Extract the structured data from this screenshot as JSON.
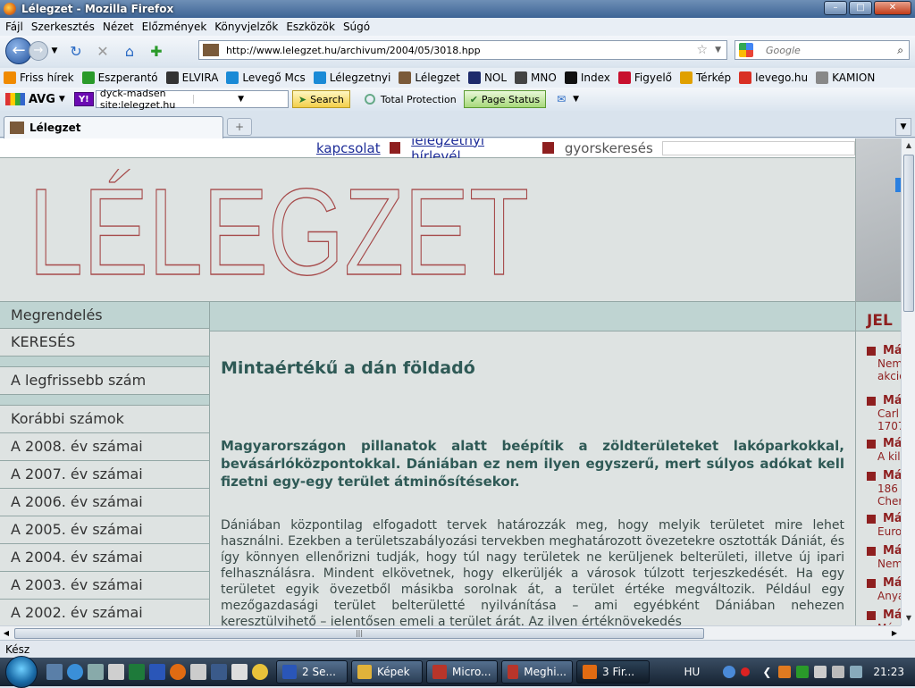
{
  "window": {
    "title": "Lélegzet - Mozilla Firefox",
    "buttons": [
      "–",
      "□",
      "✕"
    ]
  },
  "menu": [
    "Fájl",
    "Szerkesztés",
    "Nézet",
    "Előzmények",
    "Könyvjelzők",
    "Eszközök",
    "Súgó"
  ],
  "nav": {
    "url": "http://www.lelegzet.hu/archivum/2004/05/3018.hpp",
    "search_placeholder": "Google"
  },
  "bookmarks": [
    {
      "label": "Friss hírek",
      "icon": "rss-icon",
      "color": "#f08a00"
    },
    {
      "label": "Eszperantó",
      "icon": "flag-icon",
      "color": "#2a9a2a"
    },
    {
      "label": "ELVIRA",
      "icon": "train-icon",
      "color": "#333333"
    },
    {
      "label": "Levegő Mcs",
      "icon": "snowflake-icon",
      "color": "#1a8ad6"
    },
    {
      "label": "Lélegzetnyi",
      "icon": "snowflake-icon",
      "color": "#1a8ad6"
    },
    {
      "label": "Lélegzet",
      "icon": "site-icon",
      "color": "#7a5a3a"
    },
    {
      "label": "NOL",
      "icon": "nol-icon",
      "color": "#1d2a6b"
    },
    {
      "label": "MNO",
      "icon": "mno-icon",
      "color": "#444444"
    },
    {
      "label": "Index",
      "icon": "index-icon",
      "color": "#111111"
    },
    {
      "label": "Figyelő",
      "icon": "fn-icon",
      "color": "#c8102e"
    },
    {
      "label": "Térkép",
      "icon": "map-icon",
      "color": "#e0a000"
    },
    {
      "label": "levego.hu",
      "icon": "gmail-icon",
      "color": "#d93025"
    },
    {
      "label": "KAMION",
      "icon": "page-icon",
      "color": "#888888"
    }
  ],
  "avg": {
    "brand": "AVG",
    "yahoo": "Y!",
    "query": "dyck-madsen site:lelegzet.hu",
    "search_label": "Search",
    "protection_label": "Total Protection",
    "page_status_label": "Page Status"
  },
  "tab": {
    "label": "Lélegzet",
    "new_tab": "+"
  },
  "page": {
    "toplinks": {
      "contact": "kapcsolat",
      "newsletter": "lélegzetnyi hírlevél",
      "quicksearch": "gyorskeresés"
    },
    "logo_text": "LÉLEGZET",
    "leftnav": [
      "Megrendelés",
      "KERESÉS",
      "A legfrissebb szám",
      "Korábbi számok",
      "A 2008. év számai",
      "A 2007. év számai",
      "A 2006. év számai",
      "A 2005. év számai",
      "A 2004. év számai",
      "A 2003. év számai",
      "A 2002. év számai"
    ],
    "article": {
      "title": "Mintaértékű a dán földadó",
      "lead": "Magyarországon pillanatok alatt beépítik a zöldterületeket lakóparkokkal, bevásárlóközpontokkal. Dániában ez nem ilyen egyszerű, mert súlyos adókat kell fizetni egy-egy terület átminősítésekor.",
      "body": "Dániában központilag elfogadott tervek határozzák meg, hogy melyik területet mire lehet használni. Ezekben a területszabályozási tervekben meghatározott övezetekre osztották Dániát, és így könnyen ellenőrizni tudják, hogy túl nagy területek ne kerüljenek belterületi, illetve új ipari felhasználásra. Mindent elkövetnek, hogy elkerüljék a városok túlzott terjeszkedését. Ha egy területet egyik övezetből másikba sorolnak át, a terület értéke megváltozik. Például egy mezőgazdasági terület belterületté nyilvánítása – ami egyébként Dániában nehezen keresztülvihető – jelentősen emeli a terület árát. Az ilyen értéknövekedés"
    },
    "right": {
      "heading": "JEL",
      "items": [
        {
          "title": "Má",
          "sub": [
            "Nem",
            "akció"
          ]
        },
        {
          "title": "Má",
          "sub": [
            "Carl",
            "1707-"
          ]
        },
        {
          "title": "Má",
          "sub": [
            "A kil"
          ]
        },
        {
          "title": "Má",
          "sub": [
            "186",
            "Chern"
          ]
        },
        {
          "title": "Má",
          "sub": [
            "Euro"
          ]
        },
        {
          "title": "Má",
          "sub": [
            "Nem"
          ]
        },
        {
          "title": "Má",
          "sub": [
            "Anya"
          ]
        },
        {
          "title": "Má",
          "sub": [
            "Má"
          ]
        }
      ]
    }
  },
  "status": "Kész",
  "taskbar": {
    "buttons": [
      {
        "label": "2 Se...",
        "color": "#2a56b8"
      },
      {
        "label": "Képek",
        "color": "#e0b23a"
      },
      {
        "label": "Micro...",
        "color": "#b8352a"
      },
      {
        "label": "Meghi...",
        "color": "#b8352a"
      },
      {
        "label": "3 Fir...",
        "color": "#e06b12"
      }
    ],
    "lang": "HU",
    "clock": "21:23"
  }
}
